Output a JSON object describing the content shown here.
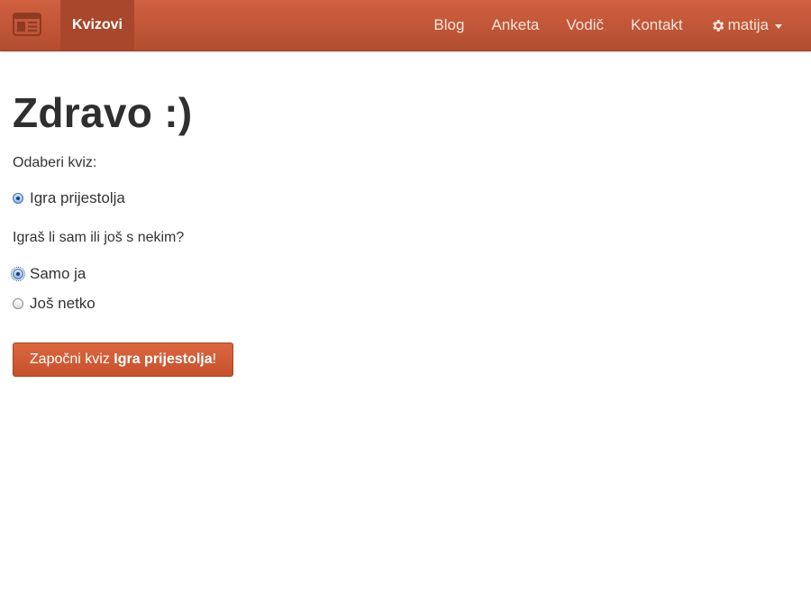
{
  "navbar": {
    "brand_icon": "newspaper-icon",
    "active_item": "Kvizovi",
    "links": [
      "Blog",
      "Anketa",
      "Vodič",
      "Kontakt"
    ],
    "user": {
      "icon": "gear-icon",
      "name": "matija"
    },
    "colors": {
      "background": "#b9533a",
      "active": "#a8472b"
    }
  },
  "main": {
    "heading": "Zdravo :)",
    "quiz_label": "Odaberi kviz:",
    "quiz_options": [
      {
        "label": "Igra prijestolja",
        "checked": true
      }
    ],
    "players_label": "Igraš li sam ili još s nekim?",
    "player_options": [
      {
        "label": "Samo ja",
        "checked": true
      },
      {
        "label": "Još netko",
        "checked": false
      }
    ],
    "start_button": {
      "prefix": "Započni kviz ",
      "quiz_name": "Igra prijestolja",
      "suffix": "!"
    },
    "button_color": "#cf5a33"
  }
}
